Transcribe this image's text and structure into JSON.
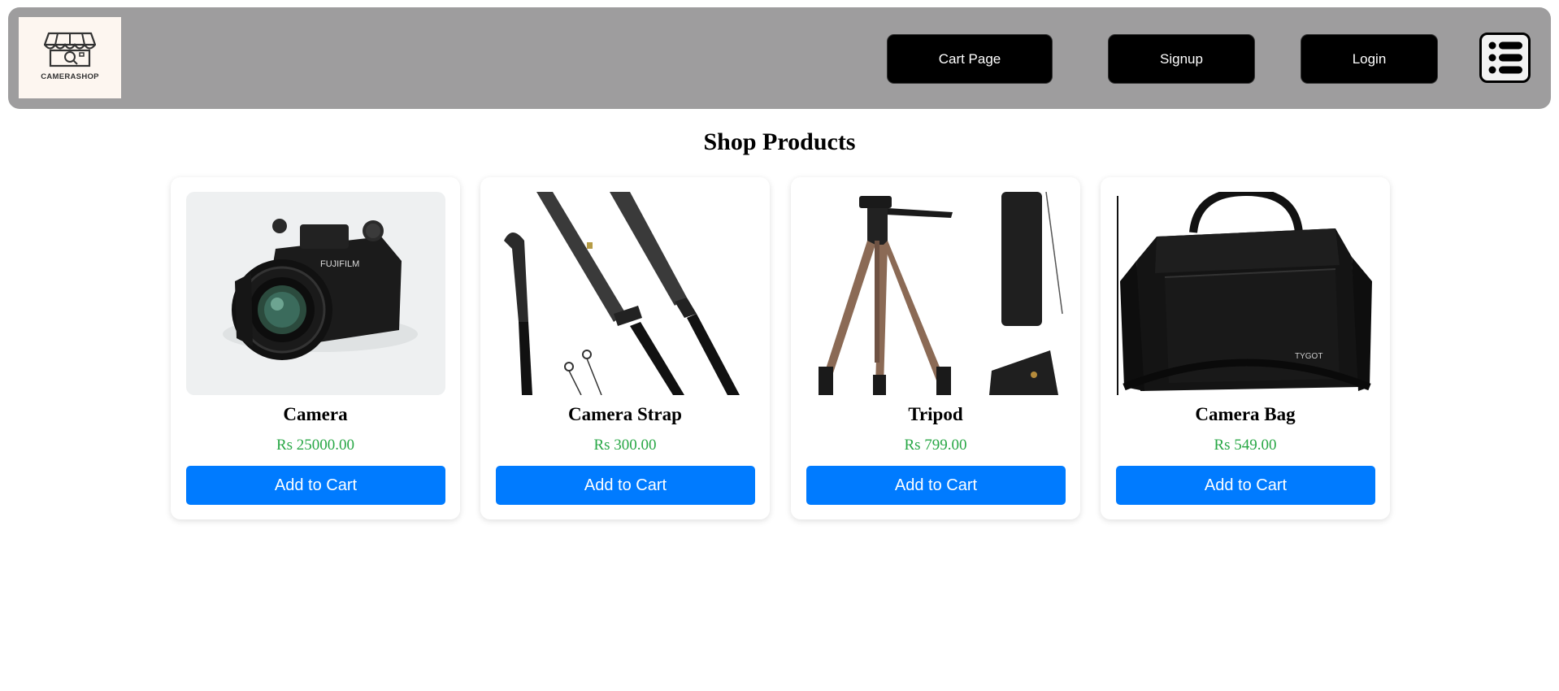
{
  "header": {
    "logo_text": "CAMERASHOP",
    "cart_label": "Cart Page",
    "signup_label": "Signup",
    "login_label": "Login"
  },
  "main": {
    "title": "Shop Products",
    "products": [
      {
        "name": "Camera",
        "price": "Rs 25000.00",
        "button": "Add to Cart"
      },
      {
        "name": "Camera Strap",
        "price": "Rs 300.00",
        "button": "Add to Cart"
      },
      {
        "name": "Tripod",
        "price": "Rs 799.00",
        "button": "Add to Cart"
      },
      {
        "name": "Camera Bag",
        "price": "Rs 549.00",
        "button": "Add to Cart"
      }
    ]
  },
  "colors": {
    "navbar": "#9e9d9e",
    "button_primary": "#007bff",
    "price": "#28a745",
    "nav_button": "#000000"
  }
}
